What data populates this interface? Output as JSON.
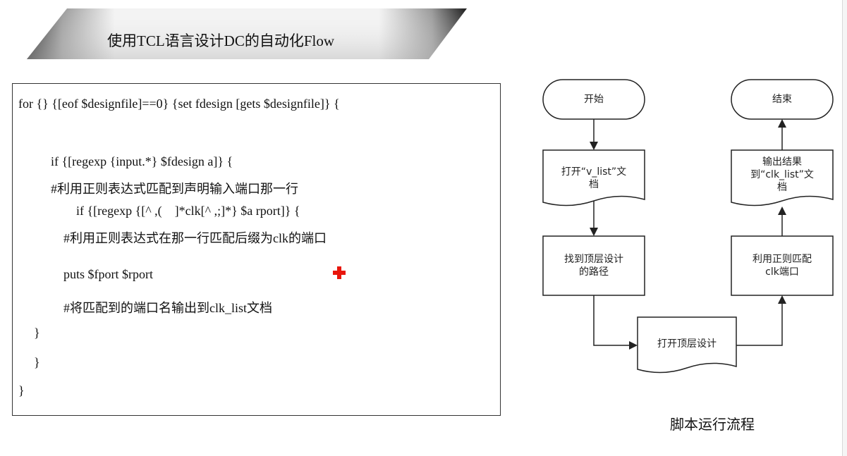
{
  "banner": {
    "title": "使用TCL语言设计DC的自动化Flow"
  },
  "code": {
    "lines": [
      "for {} {[eof $designfile]==0} {set fdesign [gets $designfile]} {",
      "if {[regexp {input.*} $fdesign a]} {",
      "#利用正则表达式匹配到声明输入端口那一行",
      "if {[regexp {[^ ,(    ]*clk[^ ,;]*} $a rport]} {",
      "#利用正则表达式在那一行匹配后缀为clk的端口",
      "puts $fport $rport",
      "#将匹配到的端口名输出到clk_list文档",
      "}",
      "}",
      "}"
    ]
  },
  "flowchart": {
    "start": "开始",
    "open_vlist_1": "打开“v_list”文",
    "open_vlist_2": "档",
    "find_path_1": "找到顶层设计",
    "find_path_2": "的路径",
    "open_top": "打开顶层设计",
    "match_clk_1": "利用正则匹配",
    "match_clk_2": "clk端口",
    "output_1": "输出结果",
    "output_2": "到“clk_list”文",
    "output_3": "档",
    "end": "结束",
    "caption": "脚本运行流程"
  },
  "colors": {
    "cursor": "#e8160c",
    "banner_dark": "#2a2a2a",
    "banner_light": "#f2f2f2"
  }
}
